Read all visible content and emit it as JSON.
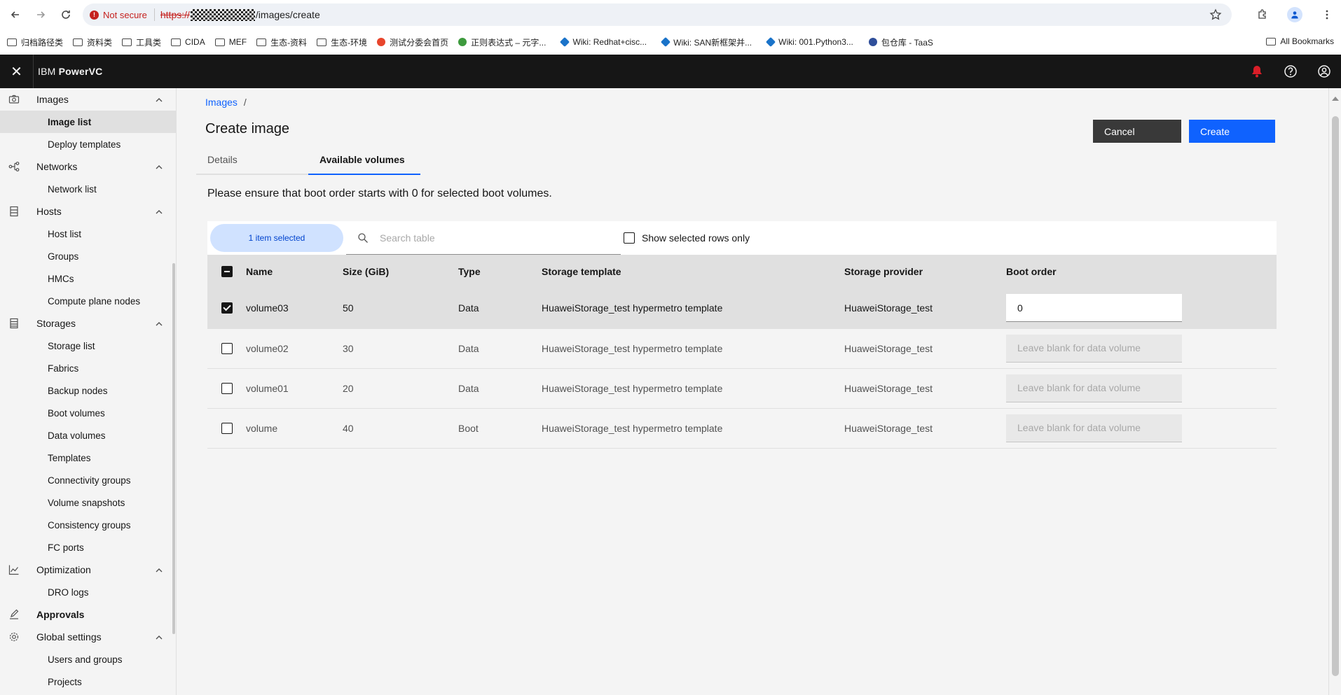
{
  "browser": {
    "security_label": "Not secure",
    "url_scheme": "https://",
    "url_path": "/images/create",
    "bookmarks": [
      {
        "label": "归档路径类",
        "kind": "folder"
      },
      {
        "label": "资料类",
        "kind": "folder"
      },
      {
        "label": "工具类",
        "kind": "folder"
      },
      {
        "label": "CIDA",
        "kind": "folder"
      },
      {
        "label": "MEF",
        "kind": "folder"
      },
      {
        "label": "生态-资料",
        "kind": "folder"
      },
      {
        "label": "生态-环境",
        "kind": "folder"
      },
      {
        "label": "测试分委会首页",
        "kind": "site"
      },
      {
        "label": "正则表达式 – 元字...",
        "kind": "site"
      },
      {
        "label": "Wiki: Redhat+cisc...",
        "kind": "site"
      },
      {
        "label": "Wiki: SAN新框架并...",
        "kind": "site"
      },
      {
        "label": "Wiki: 001.Python3...",
        "kind": "site"
      },
      {
        "label": "包仓库 - TaaS",
        "kind": "site"
      }
    ],
    "all_bookmarks": "All Bookmarks"
  },
  "header": {
    "app_title_prefix": "IBM ",
    "app_title_name": "PowerVC"
  },
  "sidebar": {
    "groups": [
      {
        "label": "Images",
        "icon": "camera-icon",
        "items": [
          "Image list",
          "Deploy templates"
        ]
      },
      {
        "label": "Networks",
        "icon": "network-icon",
        "items": [
          "Network list"
        ]
      },
      {
        "label": "Hosts",
        "icon": "server-icon",
        "items": [
          "Host list",
          "Groups",
          "HMCs",
          "Compute plane nodes"
        ]
      },
      {
        "label": "Storages",
        "icon": "storage-icon",
        "items": [
          "Storage list",
          "Fabrics",
          "Backup nodes",
          "Boot volumes",
          "Data volumes",
          "Templates",
          "Connectivity groups",
          "Volume snapshots",
          "Consistency groups",
          "FC ports"
        ]
      },
      {
        "label": "Optimization",
        "icon": "chart-line-icon",
        "items": [
          "DRO logs"
        ]
      },
      {
        "label": "Approvals",
        "icon": "edit-icon",
        "items": []
      },
      {
        "label": "Global settings",
        "icon": "settings-icon",
        "items": [
          "Users and groups",
          "Projects"
        ]
      }
    ],
    "active_item": "Image list"
  },
  "main": {
    "breadcrumb_link": "Images",
    "breadcrumb_sep": "/",
    "title": "Create image",
    "cancel_label": "Cancel",
    "create_label": "Create",
    "tabs": [
      "Details",
      "Available volumes"
    ],
    "active_tab": "Available volumes",
    "notice": "Please ensure that boot order starts with 0 for selected boot volumes.",
    "selected_count_label": "1 item selected",
    "search_placeholder": "Search table",
    "show_selected_label": "Show selected rows only",
    "columns": {
      "name": "Name",
      "size": "Size (GiB)",
      "type": "Type",
      "template": "Storage template",
      "provider": "Storage provider",
      "boot_order": "Boot order"
    },
    "rows": [
      {
        "name": "volume03",
        "size": "50",
        "type": "Data",
        "template": "HuaweiStorage_test hypermetro template",
        "provider": "HuaweiStorage_test",
        "boot_order": "0",
        "boot_placeholder": "",
        "selected": true
      },
      {
        "name": "volume02",
        "size": "30",
        "type": "Data",
        "template": "HuaweiStorage_test hypermetro template",
        "provider": "HuaweiStorage_test",
        "boot_order": "",
        "boot_placeholder": "Leave blank for data volume",
        "selected": false
      },
      {
        "name": "volume01",
        "size": "20",
        "type": "Data",
        "template": "HuaweiStorage_test hypermetro template",
        "provider": "HuaweiStorage_test",
        "boot_order": "",
        "boot_placeholder": "Leave blank for data volume",
        "selected": false
      },
      {
        "name": "volume",
        "size": "40",
        "type": "Boot",
        "template": "HuaweiStorage_test hypermetro template",
        "provider": "HuaweiStorage_test",
        "boot_order": "",
        "boot_placeholder": "Leave blank for data volume",
        "selected": false
      }
    ]
  },
  "colors": {
    "primary": "#0f62fe",
    "header_bg": "#161616",
    "notification": "#da1e28",
    "selected_pill": "#d0e2ff"
  }
}
